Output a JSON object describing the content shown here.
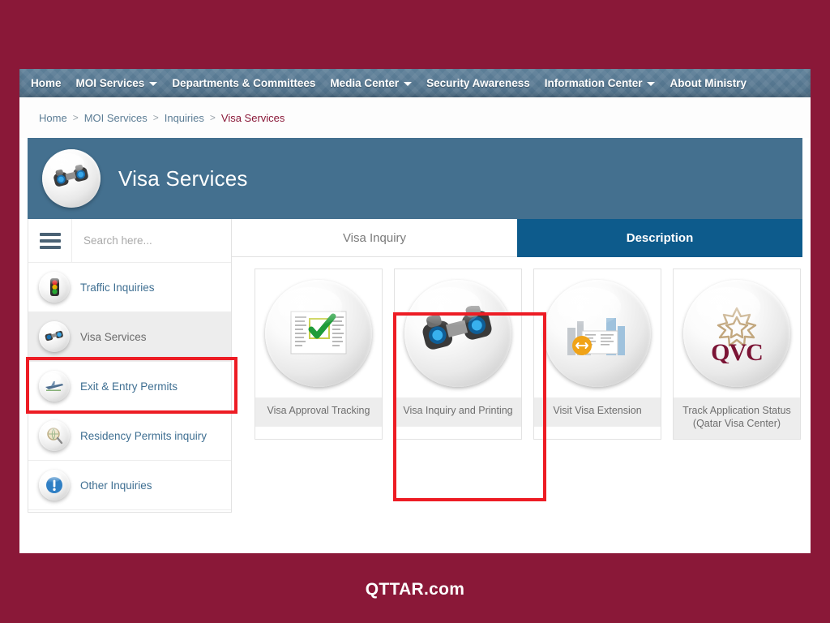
{
  "brand_colors": {
    "page_background": "#8a1838",
    "navbar": "#5c7d95",
    "banner": "#44708f",
    "active_tab": "#0d5b8c",
    "annotation_red": "#ed1c24",
    "sidebar_link": "#3f6f92"
  },
  "navbar": {
    "items": [
      {
        "label": "Home",
        "has_caret": false
      },
      {
        "label": "MOI Services",
        "has_caret": true
      },
      {
        "label": "Departments & Committees",
        "has_caret": false
      },
      {
        "label": "Media Center",
        "has_caret": true
      },
      {
        "label": "Security Awareness",
        "has_caret": false
      },
      {
        "label": "Information Center",
        "has_caret": true
      },
      {
        "label": "About Ministry",
        "has_caret": false
      }
    ]
  },
  "breadcrumb": {
    "separator": ">",
    "items": [
      {
        "label": "Home",
        "current": false
      },
      {
        "label": "MOI Services",
        "current": false
      },
      {
        "label": "Inquiries",
        "current": false
      },
      {
        "label": "Visa Services",
        "current": true
      }
    ]
  },
  "banner": {
    "title": "Visa Services",
    "icon": "binoculars-icon"
  },
  "sidebar": {
    "menu_icon": "hamburger-icon",
    "search": {
      "placeholder": "Search here...",
      "value": ""
    },
    "items": [
      {
        "label": "Traffic Inquiries",
        "icon": "traffic-light-icon",
        "active": false
      },
      {
        "label": "Visa Services",
        "icon": "binoculars-icon",
        "active": true
      },
      {
        "label": "Exit & Entry Permits",
        "icon": "airplane-icon",
        "active": false
      },
      {
        "label": "Residency Permits inquiry",
        "icon": "magnifier-globe-icon",
        "active": false
      },
      {
        "label": "Other Inquiries",
        "icon": "exclamation-icon",
        "active": false
      }
    ]
  },
  "tabs": [
    {
      "label": "Visa Inquiry",
      "active": false
    },
    {
      "label": "Description",
      "active": true
    }
  ],
  "service_cards": [
    {
      "label": "Visa Approval Tracking",
      "icon": "document-checkmark-icon",
      "highlighted": false
    },
    {
      "label": "Visa Inquiry and Printing",
      "icon": "binoculars-icon",
      "highlighted": true
    },
    {
      "label": "Visit Visa Extension",
      "icon": "city-document-extend-icon",
      "highlighted": false
    },
    {
      "label": "Track Application Status (Qatar Visa Center)",
      "icon": "qvc-logo-icon",
      "highlighted": false
    }
  ],
  "watermark": {
    "text": "QTTAR.com"
  }
}
